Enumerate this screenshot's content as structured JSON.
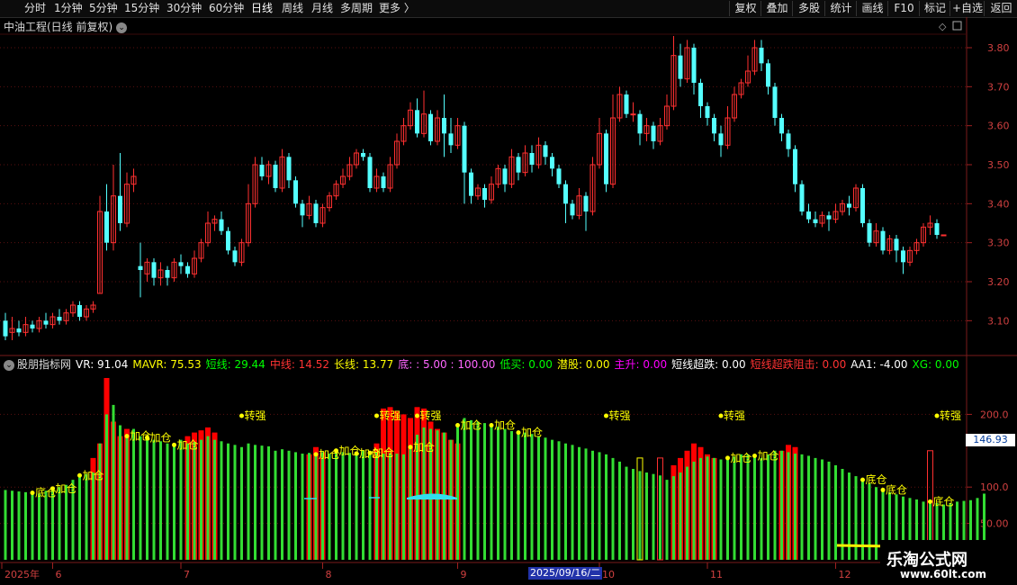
{
  "toolbar": {
    "left_items": [
      "分时",
      "1分钟",
      "5分钟",
      "15分钟",
      "30分钟",
      "60分钟",
      "日线",
      "周线",
      "月线",
      "多周期",
      "更多 〉"
    ],
    "active_item": "日线",
    "right_items": [
      "复权",
      "叠加",
      "多股",
      "统计",
      "画线",
      "F10",
      "+自选",
      "返回"
    ],
    "mark_label": "标记"
  },
  "chart_title": "中油工程(日线 前复权)",
  "price_axis": [
    "3.80",
    "3.70",
    "3.60",
    "3.50",
    "3.40",
    "3.30",
    "3.20",
    "3.10"
  ],
  "indicator": {
    "name": "股朋指标网",
    "values": [
      {
        "label": "VR: 91.04",
        "color": "#ffffff"
      },
      {
        "label": "MAVR: 75.53",
        "color": "#ffff00"
      },
      {
        "label": "短线: 29.44",
        "color": "#00ff00"
      },
      {
        "label": "中线: 14.52",
        "color": "#ff3333"
      },
      {
        "label": "长线: 13.77",
        "color": "#ffff00"
      },
      {
        "label": "底: : 5.00 : 100.00",
        "color": "#ff66ff"
      },
      {
        "label": "低买: 0.00",
        "color": "#00ff00"
      },
      {
        "label": "潜股: 0.00",
        "color": "#ffff00"
      },
      {
        "label": "主升: 0.00",
        "color": "#ff00ff"
      },
      {
        "label": "短线超跌: 0.00",
        "color": "#ffffff"
      },
      {
        "label": "短线超跌阻击: 0.00",
        "color": "#ff3333"
      },
      {
        "label": "AA1: -4.00",
        "color": "#ffffff"
      },
      {
        "label": "XG: 0.00",
        "color": "#00ff00"
      }
    ],
    "axis": [
      "200.0",
      "146.93",
      "100.0",
      "50.00"
    ],
    "current_value": "146.93",
    "signals": [
      {
        "text": "底仓",
        "i": 4
      },
      {
        "text": "加仓",
        "i": 7
      },
      {
        "text": "加仓",
        "i": 11
      },
      {
        "text": "加仓",
        "i": 18
      },
      {
        "text": "加仓",
        "i": 21
      },
      {
        "text": "加仓",
        "i": 25
      },
      {
        "text": "转强",
        "i": 35
      },
      {
        "text": "加仓",
        "i": 46
      },
      {
        "text": "加仓",
        "i": 49
      },
      {
        "text": "加仓",
        "i": 52
      },
      {
        "text": "加仓",
        "i": 54
      },
      {
        "text": "转强",
        "i": 55
      },
      {
        "text": "加仓",
        "i": 60
      },
      {
        "text": "转强",
        "i": 61
      },
      {
        "text": "加仓",
        "i": 67
      },
      {
        "text": "加仓",
        "i": 72
      },
      {
        "text": "加仓",
        "i": 76
      },
      {
        "text": "转强",
        "i": 89
      },
      {
        "text": "转强",
        "i": 106
      },
      {
        "text": "加仓",
        "i": 107
      },
      {
        "text": "加仓",
        "i": 111
      },
      {
        "text": "底仓",
        "i": 127
      },
      {
        "text": "底仓",
        "i": 130
      },
      {
        "text": "转强",
        "i": 138
      },
      {
        "text": "底仓",
        "i": 137
      }
    ]
  },
  "time_axis": {
    "labels": [
      {
        "text": "2025年",
        "i": 0
      },
      {
        "text": "6",
        "i": 7
      },
      {
        "text": "7",
        "i": 26
      },
      {
        "text": "8",
        "i": 47
      },
      {
        "text": "9",
        "i": 67
      },
      {
        "text": "10",
        "i": 88
      },
      {
        "text": "11",
        "i": 104
      },
      {
        "text": "12",
        "i": 123
      }
    ],
    "selected_date": "2025/09/16/二"
  },
  "brand": {
    "name": "乐淘公式网",
    "url": "www.60lt.com"
  },
  "chart_data": {
    "type": "candlestick",
    "price_min": 3.05,
    "price_max": 3.83,
    "candles": [
      [
        3.1,
        3.06,
        3.12,
        3.05
      ],
      [
        3.07,
        3.08,
        3.11,
        3.05
      ],
      [
        3.08,
        3.07,
        3.1,
        3.06
      ],
      [
        3.07,
        3.09,
        3.11,
        3.06
      ],
      [
        3.09,
        3.08,
        3.1,
        3.07
      ],
      [
        3.08,
        3.1,
        3.11,
        3.07
      ],
      [
        3.1,
        3.09,
        3.12,
        3.08
      ],
      [
        3.09,
        3.11,
        3.12,
        3.08
      ],
      [
        3.11,
        3.1,
        3.13,
        3.09
      ],
      [
        3.1,
        3.12,
        3.13,
        3.09
      ],
      [
        3.12,
        3.14,
        3.15,
        3.11
      ],
      [
        3.14,
        3.11,
        3.15,
        3.1
      ],
      [
        3.11,
        3.13,
        3.14,
        3.1
      ],
      [
        3.13,
        3.14,
        3.15,
        3.12
      ],
      [
        3.17,
        3.38,
        3.42,
        3.17
      ],
      [
        3.38,
        3.3,
        3.45,
        3.28
      ],
      [
        3.3,
        3.42,
        3.5,
        3.28
      ],
      [
        3.42,
        3.35,
        3.53,
        3.33
      ],
      [
        3.35,
        3.45,
        3.48,
        3.34
      ],
      [
        3.45,
        3.47,
        3.49,
        3.43
      ],
      [
        3.24,
        3.23,
        3.3,
        3.16
      ],
      [
        3.22,
        3.25,
        3.26,
        3.2
      ],
      [
        3.25,
        3.21,
        3.26,
        3.19
      ],
      [
        3.21,
        3.23,
        3.25,
        3.19
      ],
      [
        3.23,
        3.21,
        3.24,
        3.19
      ],
      [
        3.21,
        3.25,
        3.26,
        3.2
      ],
      [
        3.25,
        3.24,
        3.27,
        3.22
      ],
      [
        3.24,
        3.22,
        3.25,
        3.21
      ],
      [
        3.22,
        3.26,
        3.28,
        3.21
      ],
      [
        3.26,
        3.3,
        3.31,
        3.25
      ],
      [
        3.3,
        3.35,
        3.38,
        3.29
      ],
      [
        3.35,
        3.36,
        3.37,
        3.33
      ],
      [
        3.36,
        3.33,
        3.38,
        3.32
      ],
      [
        3.33,
        3.28,
        3.34,
        3.27
      ],
      [
        3.28,
        3.25,
        3.29,
        3.24
      ],
      [
        3.25,
        3.3,
        3.31,
        3.24
      ],
      [
        3.3,
        3.4,
        3.45,
        3.29
      ],
      [
        3.4,
        3.5,
        3.52,
        3.39
      ],
      [
        3.5,
        3.47,
        3.52,
        3.46
      ],
      [
        3.47,
        3.5,
        3.51,
        3.45
      ],
      [
        3.5,
        3.44,
        3.51,
        3.43
      ],
      [
        3.44,
        3.52,
        3.54,
        3.43
      ],
      [
        3.52,
        3.46,
        3.53,
        3.44
      ],
      [
        3.46,
        3.4,
        3.47,
        3.39
      ],
      [
        3.4,
        3.37,
        3.41,
        3.34
      ],
      [
        3.37,
        3.4,
        3.42,
        3.36
      ],
      [
        3.4,
        3.35,
        3.41,
        3.34
      ],
      [
        3.35,
        3.39,
        3.4,
        3.34
      ],
      [
        3.39,
        3.42,
        3.43,
        3.38
      ],
      [
        3.42,
        3.45,
        3.46,
        3.41
      ],
      [
        3.45,
        3.47,
        3.49,
        3.44
      ],
      [
        3.47,
        3.5,
        3.52,
        3.46
      ],
      [
        3.5,
        3.53,
        3.54,
        3.49
      ],
      [
        3.53,
        3.52,
        3.54,
        3.51
      ],
      [
        3.52,
        3.44,
        3.53,
        3.43
      ],
      [
        3.44,
        3.47,
        3.49,
        3.43
      ],
      [
        3.47,
        3.44,
        3.48,
        3.43
      ],
      [
        3.44,
        3.5,
        3.52,
        3.43
      ],
      [
        3.5,
        3.56,
        3.58,
        3.49
      ],
      [
        3.56,
        3.6,
        3.62,
        3.55
      ],
      [
        3.6,
        3.64,
        3.66,
        3.59
      ],
      [
        3.64,
        3.58,
        3.67,
        3.57
      ],
      [
        3.58,
        3.63,
        3.69,
        3.57
      ],
      [
        3.63,
        3.56,
        3.64,
        3.55
      ],
      [
        3.56,
        3.62,
        3.64,
        3.55
      ],
      [
        3.62,
        3.58,
        3.68,
        3.52
      ],
      [
        3.58,
        3.55,
        3.62,
        3.53
      ],
      [
        3.55,
        3.6,
        3.62,
        3.54
      ],
      [
        3.6,
        3.48,
        3.61,
        3.4
      ],
      [
        3.48,
        3.42,
        3.49,
        3.4
      ],
      [
        3.42,
        3.44,
        3.45,
        3.41
      ],
      [
        3.44,
        3.41,
        3.45,
        3.39
      ],
      [
        3.41,
        3.45,
        3.47,
        3.4
      ],
      [
        3.45,
        3.49,
        3.5,
        3.44
      ],
      [
        3.49,
        3.45,
        3.5,
        3.43
      ],
      [
        3.45,
        3.52,
        3.54,
        3.44
      ],
      [
        3.52,
        3.48,
        3.53,
        3.46
      ],
      [
        3.48,
        3.53,
        3.55,
        3.47
      ],
      [
        3.53,
        3.5,
        3.55,
        3.48
      ],
      [
        3.5,
        3.55,
        3.57,
        3.49
      ],
      [
        3.55,
        3.52,
        3.56,
        3.5
      ],
      [
        3.52,
        3.49,
        3.53,
        3.47
      ],
      [
        3.49,
        3.45,
        3.5,
        3.44
      ],
      [
        3.45,
        3.4,
        3.46,
        3.35
      ],
      [
        3.4,
        3.37,
        3.41,
        3.36
      ],
      [
        3.37,
        3.42,
        3.44,
        3.36
      ],
      [
        3.42,
        3.38,
        3.43,
        3.33
      ],
      [
        3.38,
        3.5,
        3.52,
        3.37
      ],
      [
        3.5,
        3.58,
        3.62,
        3.49
      ],
      [
        3.58,
        3.45,
        3.59,
        3.43
      ],
      [
        3.45,
        3.62,
        3.68,
        3.44
      ],
      [
        3.62,
        3.68,
        3.7,
        3.61
      ],
      [
        3.68,
        3.63,
        3.69,
        3.62
      ],
      [
        3.63,
        3.63,
        3.66,
        3.61
      ],
      [
        3.63,
        3.58,
        3.64,
        3.55
      ],
      [
        3.58,
        3.6,
        3.62,
        3.56
      ],
      [
        3.6,
        3.56,
        3.61,
        3.54
      ],
      [
        3.56,
        3.6,
        3.62,
        3.55
      ],
      [
        3.6,
        3.65,
        3.68,
        3.59
      ],
      [
        3.65,
        3.78,
        3.83,
        3.64
      ],
      [
        3.78,
        3.72,
        3.81,
        3.7
      ],
      [
        3.72,
        3.8,
        3.82,
        3.71
      ],
      [
        3.8,
        3.71,
        3.81,
        3.68
      ],
      [
        3.71,
        3.65,
        3.72,
        3.62
      ],
      [
        3.65,
        3.62,
        3.66,
        3.6
      ],
      [
        3.62,
        3.58,
        3.63,
        3.56
      ],
      [
        3.58,
        3.55,
        3.6,
        3.52
      ],
      [
        3.55,
        3.62,
        3.65,
        3.54
      ],
      [
        3.62,
        3.68,
        3.7,
        3.61
      ],
      [
        3.68,
        3.71,
        3.72,
        3.67
      ],
      [
        3.71,
        3.74,
        3.78,
        3.7
      ],
      [
        3.74,
        3.8,
        3.82,
        3.73
      ],
      [
        3.8,
        3.76,
        3.82,
        3.74
      ],
      [
        3.76,
        3.7,
        3.77,
        3.68
      ],
      [
        3.7,
        3.62,
        3.71,
        3.6
      ],
      [
        3.62,
        3.58,
        3.63,
        3.56
      ],
      [
        3.58,
        3.54,
        3.59,
        3.52
      ],
      [
        3.54,
        3.45,
        3.55,
        3.43
      ],
      [
        3.45,
        3.38,
        3.46,
        3.37
      ],
      [
        3.38,
        3.36,
        3.4,
        3.35
      ],
      [
        3.36,
        3.35,
        3.38,
        3.34
      ],
      [
        3.35,
        3.37,
        3.38,
        3.34
      ],
      [
        3.37,
        3.36,
        3.38,
        3.33
      ],
      [
        3.36,
        3.38,
        3.4,
        3.35
      ],
      [
        3.38,
        3.4,
        3.41,
        3.37
      ],
      [
        3.4,
        3.39,
        3.42,
        3.37
      ],
      [
        3.39,
        3.44,
        3.45,
        3.38
      ],
      [
        3.44,
        3.35,
        3.45,
        3.34
      ],
      [
        3.35,
        3.3,
        3.36,
        3.29
      ],
      [
        3.3,
        3.33,
        3.35,
        3.29
      ],
      [
        3.33,
        3.28,
        3.34,
        3.27
      ],
      [
        3.28,
        3.31,
        3.32,
        3.27
      ],
      [
        3.31,
        3.28,
        3.32,
        3.25
      ],
      [
        3.28,
        3.25,
        3.29,
        3.22
      ],
      [
        3.25,
        3.28,
        3.29,
        3.24
      ],
      [
        3.28,
        3.3,
        3.31,
        3.27
      ],
      [
        3.3,
        3.34,
        3.35,
        3.29
      ],
      [
        3.34,
        3.35,
        3.37,
        3.32
      ],
      [
        3.35,
        3.32,
        3.36,
        3.31
      ],
      [
        3.32,
        3.32,
        3.32,
        3.32
      ]
    ],
    "vr": [
      96,
      95,
      94,
      93,
      92,
      91,
      95,
      98,
      100,
      103,
      110,
      116,
      118,
      120,
      160,
      200,
      213,
      185,
      170,
      180,
      170,
      168,
      165,
      163,
      160,
      158,
      165,
      160,
      162,
      165,
      170,
      165,
      163,
      160,
      158,
      155,
      160,
      158,
      157,
      156,
      150,
      152,
      150,
      148,
      146,
      147,
      145,
      148,
      146,
      150,
      148,
      147,
      146,
      150,
      147,
      148,
      146,
      147,
      146,
      145,
      155,
      172,
      182,
      180,
      178,
      175,
      165,
      185,
      195,
      192,
      190,
      188,
      185,
      183,
      180,
      177,
      175,
      175,
      173,
      170,
      168,
      165,
      163,
      160,
      158,
      155,
      153,
      150,
      148,
      145,
      140,
      135,
      128,
      125,
      122,
      120,
      118,
      116,
      110,
      115,
      120,
      128,
      135,
      140,
      142,
      140,
      138,
      140,
      142,
      145,
      145,
      143,
      140,
      145,
      150,
      150,
      148,
      146,
      145,
      143,
      140,
      138,
      135,
      130,
      125,
      120,
      115,
      110,
      105,
      100,
      96,
      93,
      90,
      87,
      85,
      83,
      80,
      80,
      78,
      76,
      78,
      80,
      81,
      82,
      85,
      91
    ],
    "red_overlay": {
      "13": 140,
      "14": 160,
      "15": 250,
      "16": 190,
      "17": 170,
      "18": 180,
      "27": 170,
      "28": 175,
      "29": 178,
      "30": 182,
      "31": 175,
      "45": 145,
      "46": 155,
      "47": 148,
      "55": 160,
      "56": 208,
      "57": 210,
      "58": 205,
      "59": 200,
      "60": 195,
      "61": 210,
      "62": 208,
      "63": 190,
      "64": 180,
      "65": 175,
      "66": 165,
      "67": 160,
      "99": 130,
      "100": 140,
      "101": 150,
      "102": 160,
      "103": 155,
      "104": 145,
      "105": 140,
      "115": 150,
      "116": 158,
      "117": 155
    },
    "bottom_overlay": {
      "4": 1,
      "5": 1,
      "6": 1,
      "7": 1,
      "8": 1,
      "9": 1,
      "10": 1,
      "11": 1,
      "12": 1,
      "13": 1,
      "14": 1,
      "15": 1
    }
  }
}
